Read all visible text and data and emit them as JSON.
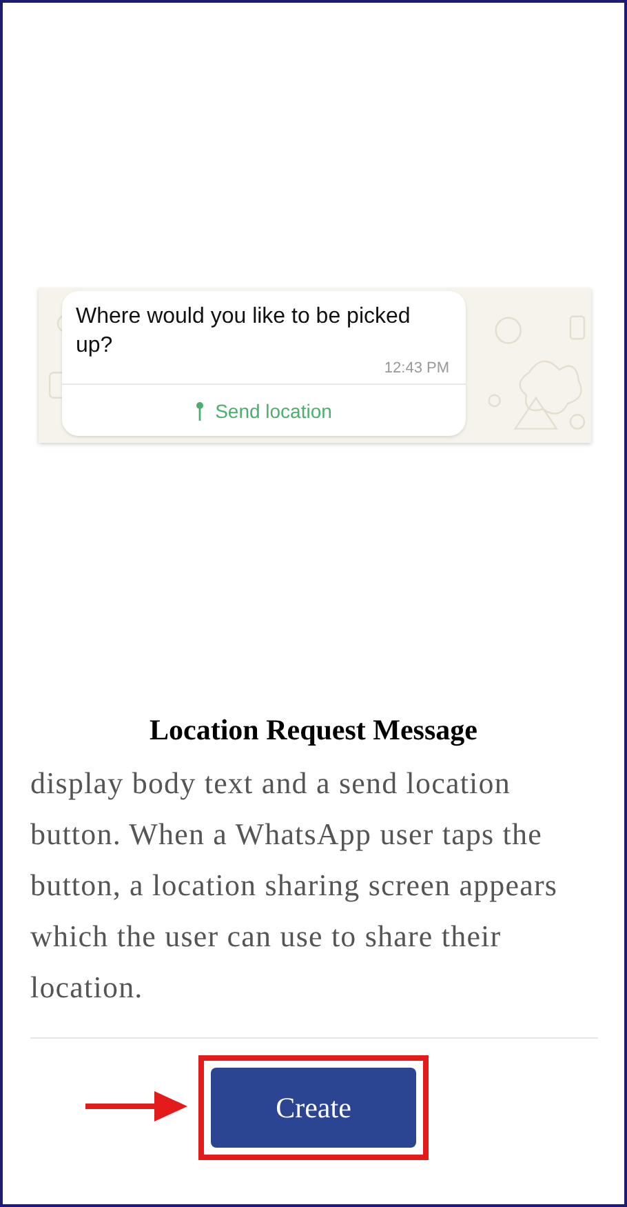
{
  "preview": {
    "message": "Where would you like to be picked up?",
    "time": "12:43 PM",
    "action": "Send location"
  },
  "title": "Location Request Message",
  "description": "display body text and a send location button. When a WhatsApp user taps the button, a location sharing screen appears which the user can use to share their location.",
  "button": "Create"
}
